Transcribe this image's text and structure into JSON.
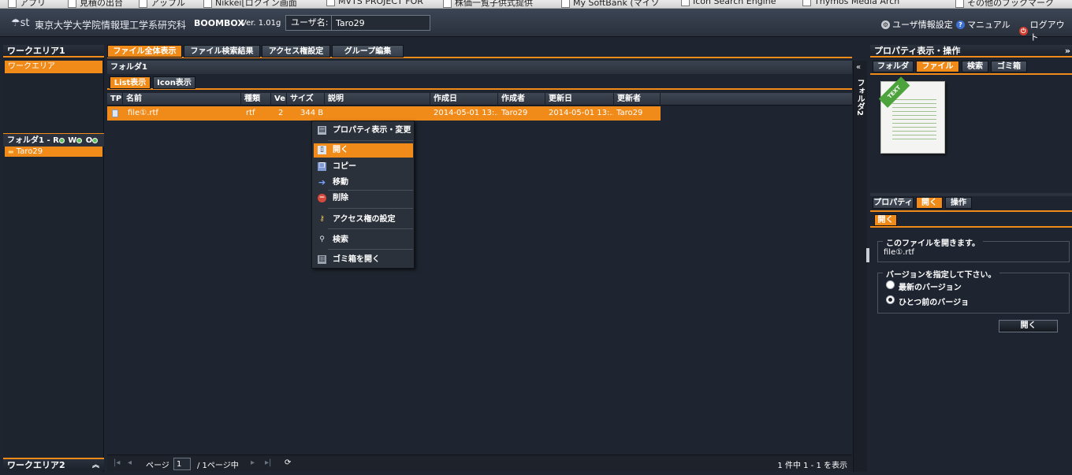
{
  "bookmarks": [
    "アプリ",
    "見積の出台",
    "アップル",
    "Nikkei[ロクイン画面",
    "MVTS PROJECT FOR",
    "株価一覧子供式提供",
    "My SoftBank (マイソ",
    "Icon Search Engine",
    "Thymos Media Arch",
    "その他のブックマーク"
  ],
  "header": {
    "institution": "東京大学大学院情報理工学系研究科",
    "app_name": "BOOMBOX",
    "version": "Ver. 1.01g",
    "user_label": "ユーザ名:",
    "user_value": "Taro29",
    "links": [
      {
        "label": "ユーザ情報設定",
        "icon": "gear-icon"
      },
      {
        "label": "マニュアル",
        "icon": "help-icon"
      },
      {
        "label": "ログアウト",
        "icon": "power-icon"
      }
    ],
    "colors": {
      "accent": "#f08a19",
      "background": "#1f2530"
    }
  },
  "left": {
    "workarea1_title": "ワークエリア1",
    "workarea_item": "ワークエリア",
    "folder_perms": "フォルダ1 - R",
    "perm_w": "W",
    "perm_o": "O",
    "folder_item": "Taro29",
    "workarea2_title": "ワークエリア2"
  },
  "main": {
    "tabs": [
      "ファイル全体表示",
      "ファイル検索結果",
      "アクセス権設定",
      "グループ編集"
    ],
    "active_tab": "ファイル全体表示",
    "breadcrumb": "フォルダ1",
    "view_tabs": [
      "List表示",
      "Icon表示"
    ],
    "columns": [
      "TP",
      "名前",
      "種類",
      "Ve",
      "サイズ",
      "説明",
      "作成日",
      "作成者",
      "更新日",
      "更新者"
    ],
    "rows": [
      {
        "name": "file①.rtf",
        "type": "rtf",
        "version": "2",
        "size": "344 B",
        "desc": "",
        "created": "2014-05-01 13:...",
        "creator": "Taro29",
        "updated": "2014-05-01 13:...",
        "updater": "Taro29"
      }
    ],
    "pager": {
      "page_label": "ページ",
      "page_value": "1",
      "of_label": "/ 1ページ中",
      "count": "1 件中 1 - 1 を表示"
    },
    "side_label": "フォルダ2"
  },
  "context_menu": {
    "items": [
      "プロパティ表示・変更",
      "開く",
      "コピー",
      "移動",
      "削除",
      "アクセス権の設定",
      "検索",
      "ゴミ箱を開く"
    ],
    "highlighted": "開く"
  },
  "right": {
    "title": "プロパティ表示・操作",
    "tabs": [
      "フォルダ",
      "ファイル",
      "検索",
      "ゴミ箱"
    ],
    "active_tab": "ファイル",
    "file_badge": "TEXT",
    "op_tabs": [
      "プロパティ",
      "開く",
      "操作"
    ],
    "active_op_tab": "開く",
    "section_title": "開く",
    "open_legend": "このファイルを開きます。",
    "open_filename": "file①.rtf",
    "version_legend": "バージョンを指定して下さい。",
    "version_options": [
      "最新のバージョン",
      "ひとつ前のバージョ"
    ],
    "version_selected": "ひとつ前のバージョ",
    "open_button": "開く"
  }
}
